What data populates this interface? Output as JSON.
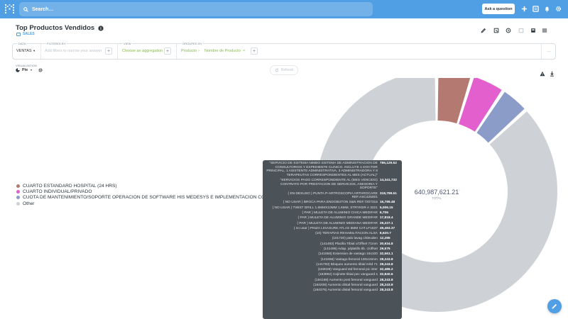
{
  "nav": {
    "search_placeholder": "Search…",
    "ask_label": "Ask a question"
  },
  "header": {
    "title": "Top Productos Vendidos",
    "collection": "SALES"
  },
  "query": {
    "data_label": "DATA",
    "data_value": "VENTAS",
    "filter_label": "FILTERED BY",
    "filter_placeholder": "Add filters to narrow your answer",
    "view_label": "VIEW",
    "view_value": "Choose an aggregation",
    "group_label": "GROUPED BY",
    "group_1": "Producto",
    "group_2": "Nombre de Producto"
  },
  "viz": {
    "label": "VISUALIZATION",
    "type": "Pie",
    "refresh": "Refresh"
  },
  "legend": [
    {
      "label": "CUARTO ESTANDARD HOSPITAL (24 HRS)",
      "color": "#b47a72"
    },
    {
      "label": "CUARTO INDIVIDUAL/PRIVADO",
      "color": "#e35fce"
    },
    {
      "label": "CUOTA DE MANTENIMIENTO/SOPORTE OPERACION DE SOFTWARE HIS MEDESYS E IMPLEMENTACION CORRE…",
      "color": "#8b9cc9"
    },
    {
      "label": "Other",
      "color": "#ced1d6"
    }
  ],
  "chart_data": {
    "type": "pie",
    "total": "640,987,621.21",
    "total_label": "TOTAL",
    "slices": [
      {
        "name": "CUARTO ESTANDARD HOSPITAL (24 HRS)",
        "fraction": 0.048,
        "color": "#b47a72"
      },
      {
        "name": "CUARTO INDIVIDUAL/PRIVADO",
        "fraction": 0.045,
        "color": "#e35fce"
      },
      {
        "name": "CUOTA DE MANTENIMIENTO/SOPORTE OPERACION DE SOFTWARE HIS MEDESYS E IMPLEMENTACION CORRE…",
        "fraction": 0.039,
        "color": "#8b9cc9"
      },
      {
        "name": "Other",
        "fraction": 0.868,
        "color": "#ced1d6"
      }
    ]
  },
  "tooltip": [
    {
      "key": "\"SERVICIO DE SISTEMA NIMBO SISTEMA DE ADMINISTRACION DE CONSULTORIOS Y EXPEDIENTE CLINICO. INCLUYE 1 DOCTOR PRINCIPAL, 1 ASISTENTE ADMINISTRATIVA, 3 ADMINISTRADORA Y 8 TERAPEUTAS CORRESPONDIENTES AL MES (ACTUAL)\"",
      "value": "786,129.52"
    },
    {
      "key": "\"SERVICIOS PAGO CORRESPONDIENTE AL (MES VENCIDO) CONTRATO POR PRESTACION DE SERVICIOS, ASESORIA Y SOPORTE\"",
      "value": "14,341,732"
    },
    {
      "key": "( EN DESUSO ) PUNTA P-ARTROSCOPIA ARTHROCARE REF.ASC425001",
      "value": "318,799.51"
    },
    {
      "key": "( NO USAR ) BROCA PARA ENDOBUTON S&N REF.7207315",
      "value": "16,789.48"
    },
    {
      "key": "( NO USAR ) TWIST DRILL 1.6MMX10MM 1.6MM, STRYKER A 3221",
      "value": "5,006.15"
    },
    {
      "key": "( PAR ) MULETA DE ALUMINIO CHICA MEDIFAR",
      "value": "6,706"
    },
    {
      "key": "( PAR ) MULETA DE ALUMINIO GRANDE MEDIFAR",
      "value": "17,818.4"
    },
    {
      "key": "( PAR ) MULETA DE ALUMINIO MEDIANA MEDIFAR",
      "value": "29,227.1"
    },
    {
      "key": "( no usar ) PINZA LIGASURE ATLAS 5MM CAT.LF1537",
      "value": "49,493.37"
    },
    {
      "key": "(10) TERAPIAS REHABILITACION ALSA",
      "value": "8,620.7"
    },
    {
      "key": "(101720) palo lavag c/sleuden",
      "value": "12,285"
    },
    {
      "key": "(141483) Placilla Tibial c/Offset 71mm",
      "value": "30,934.8"
    },
    {
      "key": "(141495) Adap. p/platillo tib. c/offset",
      "value": "29,575"
    },
    {
      "key": "(141656) Extension de vastago 16x100",
      "value": "32,561.1"
    },
    {
      "key": "(141656) Vastago femoral 130x16mm",
      "value": "28,243.8"
    },
    {
      "key": "(141783) Bloqueo aumento tibial m/td 71",
      "value": "28,243.8"
    },
    {
      "key": "(183028) Vanguard std femoral pic inter",
      "value": "32,486.2"
    },
    {
      "key": "(183892) Cojinete tibial pec vanguard s",
      "value": "32,840.6"
    },
    {
      "key": "(184168) Aumento post femoral vanguard",
      "value": "28,243.8"
    },
    {
      "key": "(184208) Aumento distal femoral vanguard",
      "value": "28,243.8"
    },
    {
      "key": "(184376) Aumento distal femoral vanguard",
      "value": "28,243.8"
    }
  ]
}
